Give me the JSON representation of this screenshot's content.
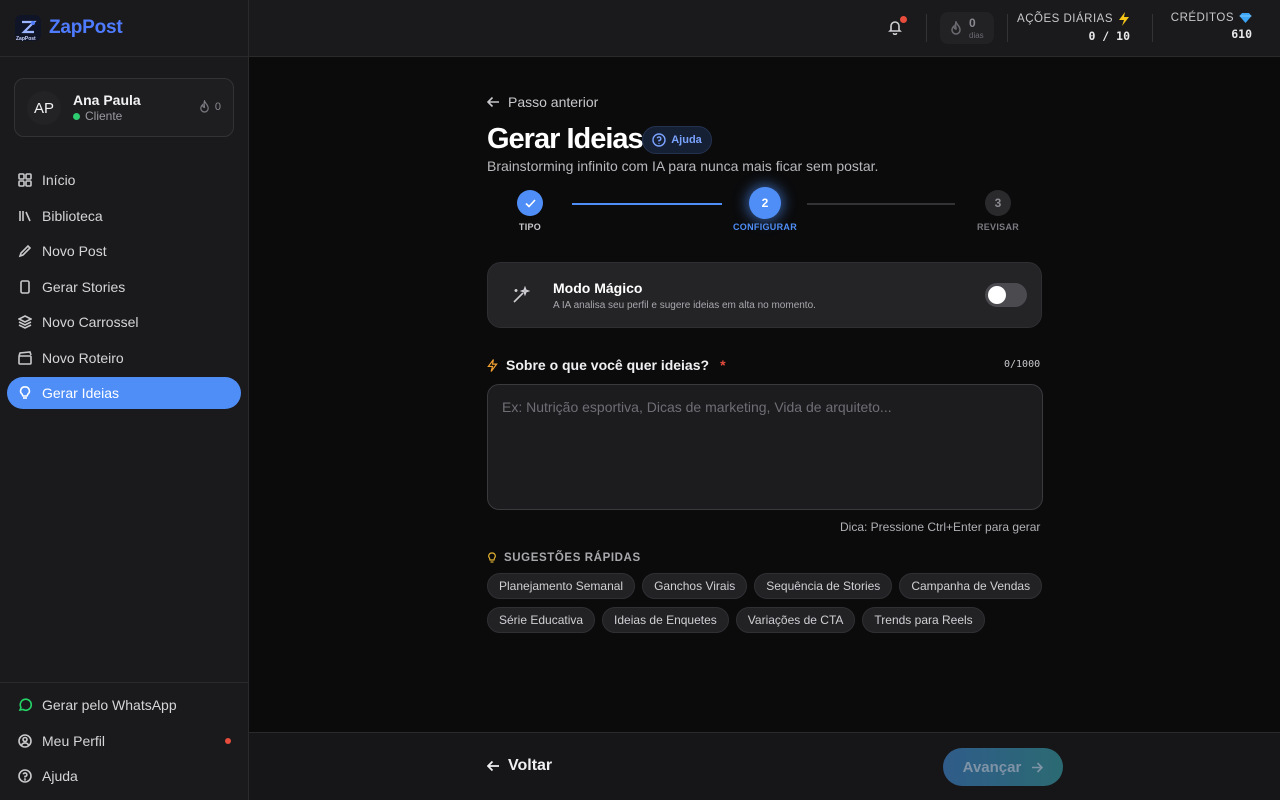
{
  "brand": {
    "name": "ZapPost",
    "logo_text": "ZapPost"
  },
  "user": {
    "initials": "AP",
    "name": "Ana Paula",
    "role": "Cliente",
    "streak": "0"
  },
  "sidebar": {
    "items": [
      {
        "label": "Início",
        "icon": "grid-icon"
      },
      {
        "label": "Biblioteca",
        "icon": "library-icon"
      },
      {
        "label": "Novo Post",
        "icon": "pen-icon"
      },
      {
        "label": "Gerar Stories",
        "icon": "phone-icon"
      },
      {
        "label": "Novo Carrossel",
        "icon": "layers-icon"
      },
      {
        "label": "Novo Roteiro",
        "icon": "clapper-icon"
      },
      {
        "label": "Gerar Ideias",
        "icon": "lightbulb-icon",
        "active": true
      }
    ],
    "bottom": [
      {
        "label": "Gerar pelo WhatsApp",
        "icon": "whatsapp-icon"
      },
      {
        "label": "Meu Perfil",
        "icon": "user-circle-icon"
      },
      {
        "label": "Ajuda",
        "icon": "help-circle-icon"
      }
    ]
  },
  "topbar": {
    "streak_value": "0",
    "streak_unit": "dias",
    "daily_label": "AÇÕES DIÁRIAS",
    "daily_value": "0 / 10",
    "credits_label": "CRÉDITOS",
    "credits_value": "610"
  },
  "page": {
    "back": "Passo anterior",
    "title": "Gerar Ideias",
    "help": "Ajuda",
    "subtitle": "Brainstorming infinito com IA para nunca mais ficar sem postar."
  },
  "steps": [
    {
      "num": "1",
      "label": "TIPO",
      "state": "done"
    },
    {
      "num": "2",
      "label": "CONFIGURAR",
      "state": "active"
    },
    {
      "num": "3",
      "label": "REVISAR",
      "state": "pending"
    }
  ],
  "magic": {
    "title": "Modo Mágico",
    "description": "A IA analisa seu perfil e sugere ideias em alta no momento.",
    "enabled": false
  },
  "prompt": {
    "label": "Sobre o que você quer ideias?",
    "required": "*",
    "counter": "0/1000",
    "placeholder": "Ex: Nutrição esportiva, Dicas de marketing, Vida de arquiteto...",
    "tip": "Dica: Pressione Ctrl+Enter para gerar"
  },
  "suggestions": {
    "title": "SUGESTÕES RÁPIDAS",
    "chips": [
      "Planejamento Semanal",
      "Ganchos Virais",
      "Sequência de Stories",
      "Campanha de Vendas",
      "Série Educativa",
      "Ideias de Enquetes",
      "Variações de CTA",
      "Trends para Reels"
    ]
  },
  "footer": {
    "back": "Voltar",
    "next": "Avançar"
  },
  "colors": {
    "accent": "#4f8ef7",
    "brand": "#4f7bff",
    "danger": "#e74c3c",
    "online": "#2ecc71"
  }
}
